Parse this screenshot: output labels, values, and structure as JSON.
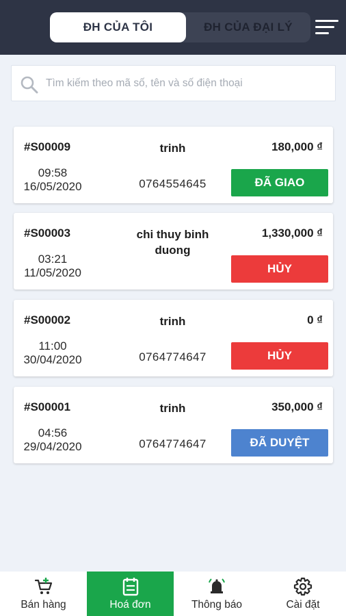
{
  "header": {
    "tabs": [
      {
        "label": "ĐH CỦA TÔI",
        "active": true
      },
      {
        "label": "ĐH CỦA ĐẠI LÝ",
        "active": false
      }
    ],
    "menu_icon": "filter-menu-icon"
  },
  "search": {
    "placeholder": "Tìm kiếm theo mã số, tên và số điện thoại",
    "value": "",
    "icon": "search-icon"
  },
  "orders": [
    {
      "id": "#S00009",
      "time": "09:58",
      "date": "16/05/2020",
      "name": "trinh",
      "phone": "0764554645",
      "amount": "180,000 ₫",
      "status": "ĐÃ GIAO",
      "status_color": "#1aa64b"
    },
    {
      "id": "#S00003",
      "time": "03:21",
      "date": "11/05/2020",
      "name": "chi thuy binh duong",
      "phone": "",
      "amount": "1,330,000 ₫",
      "status": "HỦY",
      "status_color": "#ec3b3b"
    },
    {
      "id": "#S00002",
      "time": "11:00",
      "date": "30/04/2020",
      "name": "trinh",
      "phone": "0764774647",
      "amount": "0 ₫",
      "status": "HỦY",
      "status_color": "#ec3b3b"
    },
    {
      "id": "#S00001",
      "time": "04:56",
      "date": "29/04/2020",
      "name": "trinh",
      "phone": "0764774647",
      "amount": "350,000 ₫",
      "status": "ĐÃ DUYỆT",
      "status_color": "#4d83cf"
    }
  ],
  "nav": [
    {
      "label": "Bán hàng",
      "icon": "cart-add-icon",
      "active": false
    },
    {
      "label": "Hoá đơn",
      "icon": "invoice-icon",
      "active": true
    },
    {
      "label": "Thông báo",
      "icon": "bell-icon",
      "active": false
    },
    {
      "label": "Cài đặt",
      "icon": "gear-icon",
      "active": false
    }
  ],
  "colors": {
    "header_bg": "#2e3445",
    "page_bg": "#eef2f8",
    "accent_green": "#1aa64b",
    "cancel_red": "#ec3b3b",
    "approved_blue": "#4d83cf"
  }
}
